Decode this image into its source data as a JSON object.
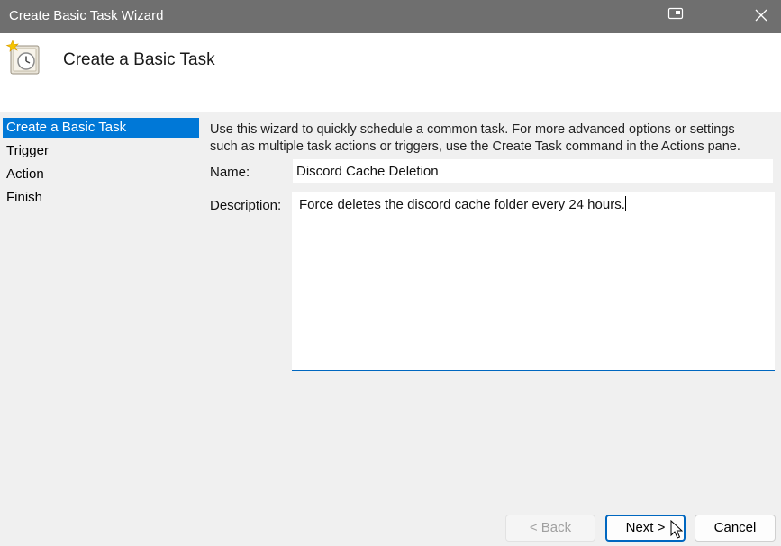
{
  "window": {
    "title": "Create Basic Task Wizard"
  },
  "header": {
    "heading": "Create a Basic Task",
    "icon": "task-scheduler-clock-icon"
  },
  "sidebar": {
    "items": [
      {
        "label": "Create a Basic Task",
        "active": true
      },
      {
        "label": "Trigger",
        "active": false
      },
      {
        "label": "Action",
        "active": false
      },
      {
        "label": "Finish",
        "active": false
      }
    ]
  },
  "main": {
    "intro_line1": "Use this wizard to quickly schedule a common task.  For more advanced options or settings",
    "intro_line2": "such as multiple task actions or triggers, use the Create Task command in the Actions pane.",
    "name_label": "Name:",
    "name_value": "Discord Cache Deletion",
    "description_label": "Description:",
    "description_value": "Force deletes the discord cache folder every 24 hours."
  },
  "buttons": {
    "back_label": "< Back",
    "next_label": "Next >",
    "cancel_label": "Cancel"
  },
  "colors": {
    "titlebar": "#6f6f6f",
    "selection": "#0078d7",
    "accent": "#0067c0",
    "background": "#f0f0f0"
  }
}
